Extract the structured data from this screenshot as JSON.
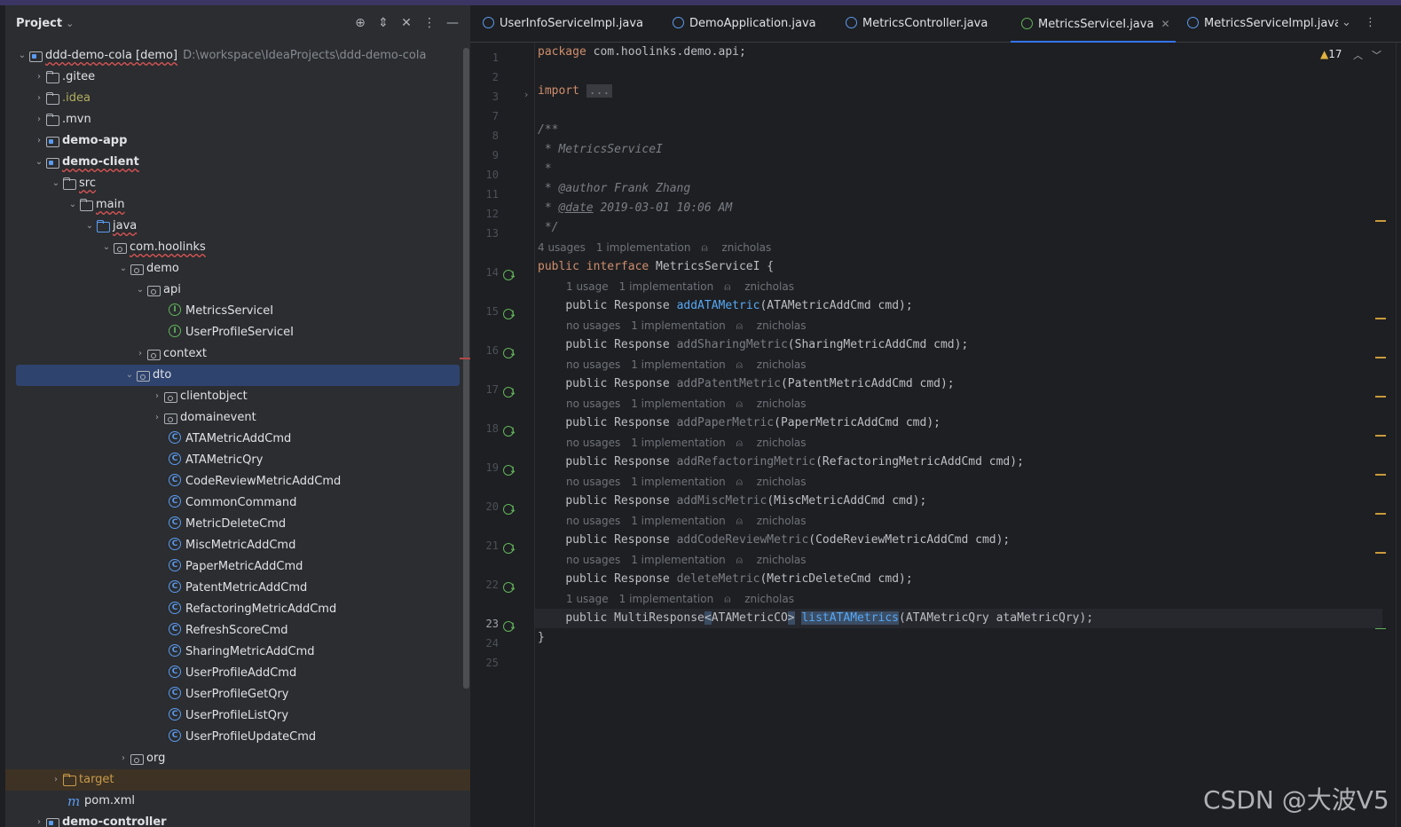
{
  "project_panel": {
    "title": "Project",
    "tree": [
      {
        "label": "ddd-demo-cola [demo]",
        "path": "D:\\workspace\\IdeaProjects\\ddd-demo-cola"
      },
      {
        "label": ".gitee"
      },
      {
        "label": ".idea"
      },
      {
        "label": ".mvn"
      },
      {
        "label": "demo-app"
      },
      {
        "label": "demo-client"
      },
      {
        "label": "src"
      },
      {
        "label": "main"
      },
      {
        "label": "java"
      },
      {
        "label": "com.hoolinks"
      },
      {
        "label": "demo"
      },
      {
        "label": "api"
      },
      {
        "label": "MetricsServiceI"
      },
      {
        "label": "UserProfileServiceI"
      },
      {
        "label": "context"
      },
      {
        "label": "dto"
      },
      {
        "label": "clientobject"
      },
      {
        "label": "domainevent"
      },
      {
        "label": "ATAMetricAddCmd"
      },
      {
        "label": "ATAMetricQry"
      },
      {
        "label": "CodeReviewMetricAddCmd"
      },
      {
        "label": "CommonCommand"
      },
      {
        "label": "MetricDeleteCmd"
      },
      {
        "label": "MiscMetricAddCmd"
      },
      {
        "label": "PaperMetricAddCmd"
      },
      {
        "label": "PatentMetricAddCmd"
      },
      {
        "label": "RefactoringMetricAddCmd"
      },
      {
        "label": "RefreshScoreCmd"
      },
      {
        "label": "SharingMetricAddCmd"
      },
      {
        "label": "UserProfileAddCmd"
      },
      {
        "label": "UserProfileGetQry"
      },
      {
        "label": "UserProfileListQry"
      },
      {
        "label": "UserProfileUpdateCmd"
      },
      {
        "label": "org"
      },
      {
        "label": "target"
      },
      {
        "label": "pom.xml"
      },
      {
        "label": "demo-controller"
      }
    ]
  },
  "tabs": [
    {
      "label": "UserInfoServiceImpl.java"
    },
    {
      "label": "DemoApplication.java"
    },
    {
      "label": "MetricsController.java"
    },
    {
      "label": "MetricsServiceI.java",
      "active": true
    },
    {
      "label": "MetricsServiceImpl.java"
    }
  ],
  "editor": {
    "warning_count": "17",
    "line_numbers": [
      "1",
      "2",
      "3",
      "7",
      "8",
      "9",
      "10",
      "11",
      "12",
      "13",
      "14",
      "15",
      "16",
      "17",
      "18",
      "19",
      "20",
      "21",
      "22",
      "23",
      "24",
      "25"
    ],
    "code": {
      "package_kw": "package",
      "package_name": " com.hoolinks.demo.api;",
      "import_kw": "import",
      "import_fold": "...",
      "doc_open": "/**",
      "doc_name": " * MetricsServiceI",
      "doc_blank": " *",
      "doc_author_tag": "@author",
      "doc_author": " Frank Zhang",
      "doc_date_tag": "@date",
      "doc_date": " 2019-03-01 10:06 AM",
      "doc_close": " */",
      "iface_kw": "public interface",
      "iface_name": " MetricsServiceI {",
      "close_brace": "}"
    },
    "hints": {
      "iface": [
        "4 usages",
        "1 implementation",
        "znicholas"
      ],
      "m1": [
        "1 usage",
        "1 implementation",
        "znicholas"
      ],
      "m2": [
        "no usages",
        "1 implementation",
        "znicholas"
      ],
      "m3": [
        "no usages",
        "1 implementation",
        "znicholas"
      ],
      "m4": [
        "no usages",
        "1 implementation",
        "znicholas"
      ],
      "m5": [
        "no usages",
        "1 implementation",
        "znicholas"
      ],
      "m6": [
        "no usages",
        "1 implementation",
        "znicholas"
      ],
      "m7": [
        "no usages",
        "1 implementation",
        "znicholas"
      ],
      "m8": [
        "no usages",
        "1 implementation",
        "znicholas"
      ],
      "m9": [
        "1 usage",
        "1 implementation",
        "znicholas"
      ]
    },
    "methods": [
      {
        "mod": "public",
        "ret": " Response ",
        "name": "addATAMetric",
        "params": "(ATAMetricAddCmd cmd);"
      },
      {
        "mod": "public",
        "ret": " Response ",
        "name": "addSharingMetric",
        "params": "(SharingMetricAddCmd cmd);"
      },
      {
        "mod": "public",
        "ret": " Response ",
        "name": "addPatentMetric",
        "params": "(PatentMetricAddCmd cmd);"
      },
      {
        "mod": "public",
        "ret": " Response ",
        "name": "addPaperMetric",
        "params": "(PaperMetricAddCmd cmd);"
      },
      {
        "mod": "public",
        "ret": " Response ",
        "name": "addRefactoringMetric",
        "params": "(RefactoringMetricAddCmd cmd);"
      },
      {
        "mod": "public",
        "ret": " Response ",
        "name": "addMiscMetric",
        "params": "(MiscMetricAddCmd cmd);"
      },
      {
        "mod": "public",
        "ret": " Response ",
        "name": "addCodeReviewMetric",
        "params": "(CodeReviewMetricAddCmd cmd);"
      },
      {
        "mod": "public",
        "ret": " Response ",
        "name": "deleteMetric",
        "params": "(MetricDeleteCmd cmd);"
      },
      {
        "mod": "public",
        "ret_a": " MultiResponse",
        "ret_lt": "<",
        "ret_b": "ATAMetricCO",
        "ret_gt": ">",
        "name": "listATAMetrics",
        "params": "(ATAMetricQry ataMetricQry);"
      }
    ]
  },
  "watermark": "CSDN @大波V5",
  "colors": {
    "accent": "#3574f0",
    "selection": "#2e436e",
    "keyword": "#cf8e6d",
    "method": "#56a8f5",
    "interface": "#61b35a"
  }
}
